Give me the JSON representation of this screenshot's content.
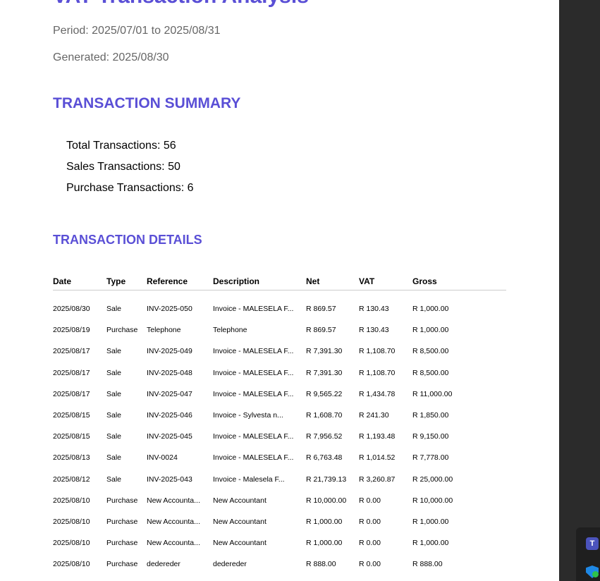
{
  "report": {
    "title": "VAT Transaction Analysis",
    "period": "Period: 2025/07/01 to 2025/08/31",
    "generated": "Generated: 2025/08/30"
  },
  "summary": {
    "heading": "TRANSACTION SUMMARY",
    "total": "Total Transactions: 56",
    "sales": "Sales Transactions: 50",
    "purchases": "Purchase Transactions: 6"
  },
  "details": {
    "heading": "TRANSACTION DETAILS",
    "columns": [
      "Date",
      "Type",
      "Reference",
      "Description",
      "Net",
      "VAT",
      "Gross"
    ],
    "rows": [
      [
        "2025/08/30",
        "Sale",
        "INV-2025-050",
        "Invoice - MALESELA F...",
        "R 869.57",
        "R 130.43",
        "R 1,000.00"
      ],
      [
        "2025/08/19",
        "Purchase",
        "Telephone",
        "Telephone",
        "R 869.57",
        "R 130.43",
        "R 1,000.00"
      ],
      [
        "2025/08/17",
        "Sale",
        "INV-2025-049",
        "Invoice - MALESELA F...",
        "R 7,391.30",
        "R 1,108.70",
        "R 8,500.00"
      ],
      [
        "2025/08/17",
        "Sale",
        "INV-2025-048",
        "Invoice - MALESELA F...",
        "R 7,391.30",
        "R 1,108.70",
        "R 8,500.00"
      ],
      [
        "2025/08/17",
        "Sale",
        "INV-2025-047",
        "Invoice - MALESELA F...",
        "R 9,565.22",
        "R 1,434.78",
        "R 11,000.00"
      ],
      [
        "2025/08/15",
        "Sale",
        "INV-2025-046",
        "Invoice - Sylvesta n...",
        "R 1,608.70",
        "R 241.30",
        "R 1,850.00"
      ],
      [
        "2025/08/15",
        "Sale",
        "INV-2025-045",
        "Invoice - MALESELA F...",
        "R 7,956.52",
        "R 1,193.48",
        "R 9,150.00"
      ],
      [
        "2025/08/13",
        "Sale",
        "INV-0024",
        "Invoice - MALESELA F...",
        "R 6,763.48",
        "R 1,014.52",
        "R 7,778.00"
      ],
      [
        "2025/08/12",
        "Sale",
        "INV-2025-043",
        "Invoice - Malesela F...",
        "R 21,739.13",
        "R 3,260.87",
        "R 25,000.00"
      ],
      [
        "2025/08/10",
        "Purchase",
        "New Accounta...",
        "New Accountant",
        "R 10,000.00",
        "R 0.00",
        "R 10,000.00"
      ],
      [
        "2025/08/10",
        "Purchase",
        "New Accounta...",
        "New Accountant",
        "R 1,000.00",
        "R 0.00",
        "R 1,000.00"
      ],
      [
        "2025/08/10",
        "Purchase",
        "New Accounta...",
        "New Accountant",
        "R 1,000.00",
        "R 0.00",
        "R 1,000.00"
      ],
      [
        "2025/08/10",
        "Purchase",
        "dedereder",
        "dedereder",
        "R 888.00",
        "R 0.00",
        "R 888.00"
      ]
    ]
  },
  "taskbar": {
    "teams_glyph": "T",
    "icons": [
      "teams-icon",
      "defender-icon"
    ]
  }
}
